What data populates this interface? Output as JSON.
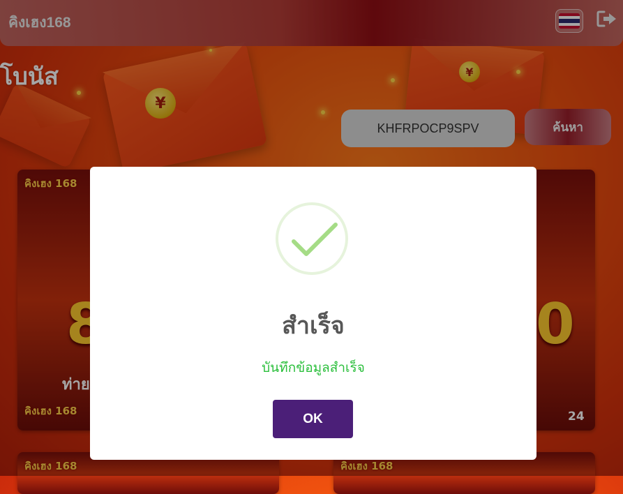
{
  "header": {
    "brand": "คิงเฮง168",
    "language_flag": "thailand-flag-icon",
    "logout_icon": "logout-icon"
  },
  "page": {
    "title": "โบนัส"
  },
  "search": {
    "value": "KHFRPOCP9SPV",
    "button_label": "ค้นหา"
  },
  "cards": [
    {
      "logo": "คิงเฮง 168",
      "big_text": "8",
      "caption": "ท่าย"
    },
    {
      "logo": "",
      "big_text": "0",
      "caption": "",
      "footer": "24"
    }
  ],
  "bottom_cards": [
    {
      "logo": "คิงเฮง 168"
    },
    {
      "logo": "คิงเฮง 168"
    }
  ],
  "modal": {
    "icon": "checkmark-icon",
    "title": "สำเร็จ",
    "message": "บันทึกข้อมูลสำเร็จ",
    "ok_label": "OK"
  },
  "colors": {
    "accent": "#4b1f78",
    "success": "#2bbf3c",
    "check": "#a5dc86"
  }
}
